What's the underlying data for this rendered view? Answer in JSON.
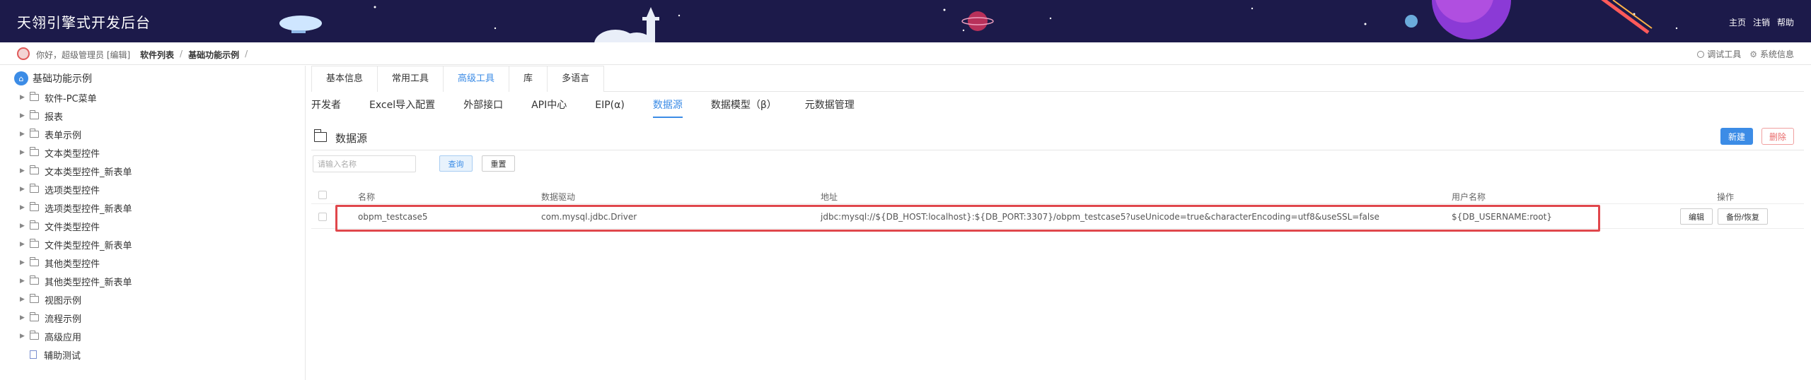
{
  "header": {
    "title": "天翎引擎式开发后台",
    "nav": [
      "主页",
      "注销",
      "帮助"
    ]
  },
  "breadcrumb": {
    "greeting": "你好，超级管理员 [编辑]",
    "items": [
      "软件列表",
      "基础功能示例"
    ],
    "separator": "/",
    "tools": [
      "调试工具",
      "系统信息"
    ]
  },
  "sidebar": {
    "root": "基础功能示例",
    "items": [
      "软件-PC菜单",
      "报表",
      "表单示例",
      "文本类型控件",
      "文本类型控件_新表单",
      "选项类型控件",
      "选项类型控件_新表单",
      "文件类型控件",
      "文件类型控件_新表单",
      "其他类型控件",
      "其他类型控件_新表单",
      "视图示例",
      "流程示例",
      "高级应用"
    ],
    "leaf": "辅助测试"
  },
  "tabs_primary": {
    "items": [
      "基本信息",
      "常用工具",
      "高级工具",
      "库",
      "多语言"
    ],
    "active_index": 2
  },
  "tabs_secondary": {
    "items": [
      "开发者",
      "Excel导入配置",
      "外部接口",
      "API中心",
      "EIP(α)",
      "数据源",
      "数据模型（β）",
      "元数据管理"
    ],
    "active_index": 5
  },
  "section": {
    "title": "数据源",
    "new_label": "新建",
    "delete_label": "删除"
  },
  "filter": {
    "placeholder": "请输入名称",
    "query_label": "查询",
    "reset_label": "重置"
  },
  "table": {
    "columns": [
      "名称",
      "数据驱动",
      "地址",
      "用户名称",
      "操作"
    ],
    "rows": [
      {
        "name": "obpm_testcase5",
        "driver": "com.mysql.jdbc.Driver",
        "url": "jdbc:mysql://${DB_HOST:localhost}:${DB_PORT:3307}/obpm_testcase5?useUnicode=true&characterEncoding=utf8&useSSL=false",
        "username": "${DB_USERNAME:root}",
        "actions": [
          "编辑",
          "备份/恢复"
        ]
      }
    ]
  },
  "colors": {
    "header_bg": "#1c1a4a",
    "accent": "#3c8ce6",
    "highlight": "#e0474c"
  }
}
